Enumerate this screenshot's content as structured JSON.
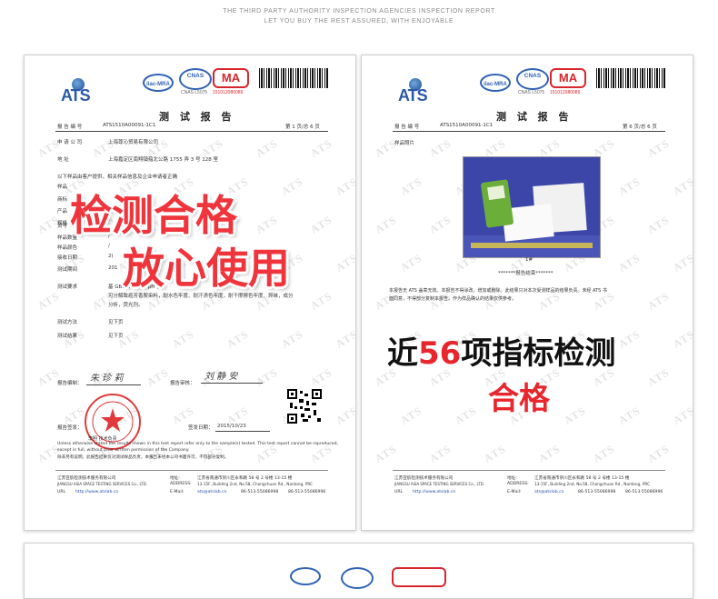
{
  "header": {
    "line1": "THE THIRD PARTY AUTHORITY INSPECTION AGENCIES INSPECTION REPORT",
    "line2": "LET YOU BUY THE REST ASSURED, WITH ENJOYABLE"
  },
  "watermark": "ATS",
  "logos": {
    "ats": "ATS",
    "ilac": "ilac-MRA",
    "cnas": "CNAS",
    "cnas_sub": "CNAS L5075",
    "ma": "MA",
    "ma_number": "151012080089"
  },
  "left_doc": {
    "title": "测 试 报 告",
    "report_no_label": "报 告 编 号",
    "report_no": "ATS1510A00091-1C1",
    "page": "第 1 页/总 6 页",
    "applicant_label": "申 请 公 司",
    "applicant": "上海尊沁贸易有限公司",
    "address_label": "地     址",
    "address": "上海嘉定区南翔镇蕴北公路 1755 弄 3 号 128 室",
    "note": "以下样品由客户提供，相关样品信息及企业申请者正确",
    "fields": [
      {
        "label": "样品数量",
        "value": "/"
      },
      {
        "label": "样品颜色",
        "value": "/"
      },
      {
        "label": "接收日期",
        "value": "2("
      },
      {
        "label": "测试期间",
        "value": "201"
      }
    ],
    "partial_labels": [
      "样品",
      "商标",
      "产品",
      "规格",
      "货号"
    ],
    "req_label": "测试要求",
    "req_text_1": "基   GB1   B 规   F下   pH 值,",
    "req_text_2": "可分解致癌芳香胺染料，耐水色牢度、耐汗渍色牢度，耐干摩擦色牢度、异味，成分",
    "req_text_3": "分析，荧光剂。",
    "method_label": "测试方法",
    "method": "见下页",
    "result_label": "测试结果",
    "result": "见下页",
    "compiler_label": "报告编制：",
    "compiler_sig": "朱 珍 莉",
    "reviewer_label": "报告审核：",
    "reviewer_sig": "刘 静 安",
    "approver_label": "报告签发：",
    "approver_name": "李明   技术负责",
    "issue_date_label": "签发日期：",
    "issue_date": "2015/10/23",
    "disclaimer_en_1": "Unless otherwise stated the results shown in this test report refer only to the sample(s) tested. This test report cannot be reproduced,",
    "disclaimer_en_2": "except in full, without prior written permission of the Company.",
    "disclaimer_cn_1": "除非另有说明，此报告结果仅对测试样品负责，本报告未经本公司书面许可，不可部分复制。",
    "footer_company_cn": "江苏亚航检测技术服务有限公司",
    "footer_company_en": "JIANGSU ASIA SPACE TESTING SERVICES Co., LTD.",
    "footer_url_label": "URL",
    "footer_url": "http://www.atslab.cn",
    "footer_addr_label": "地址:",
    "footer_addr_cn": "江苏省南通市崇川区永和路 58 号 2 号楼 13-15 楼",
    "footer_address_label": "ADDRESS:",
    "footer_addr_en": "13-15F, Building 2nd, No.58, Chongchuan Rd., Nantong, PRC",
    "footer_email_label": "E-Mail:",
    "footer_email": "ats@atslab.cn",
    "footer_tel": "86-513-55086998",
    "footer_fax": "86-513-55086996",
    "overlay_1": "检测合格",
    "overlay_2": "放心使用"
  },
  "right_doc": {
    "title": "测 试 报 告",
    "report_no_label": "报 告 编 号",
    "report_no": "ATS1510A00091-1C1",
    "page": "第 6 页/总 6 页",
    "photo_label": "样品照片",
    "photo_caption": "1#",
    "end_mark": "*******报告结束*******",
    "note_1": "本报告无 ATS 盖章无效。本报告不得涂改，增加或删除。此结果只对本次受测样品的结果负责。未经 ATS 书",
    "note_2": "面同意，不得部分复制本报告。作为样品确认的结果仅供参考。",
    "promo_pre": "近",
    "promo_num": "56",
    "promo_post": "项指标检测",
    "promo_line2": "合格",
    "footer_company_cn": "江苏亚航检测技术服务有限公司",
    "footer_company_en": "JIANGSU ASIA SPACE TESTING SERVICES Co., LTD.",
    "footer_url_label": "URL",
    "footer_url": "http://www.atslab.cn",
    "footer_addr_label": "地址:",
    "footer_addr_cn": "江苏省南通市崇川区永和路 58 号 2 号楼 13-15 楼",
    "footer_address_label": "ADDRESS:",
    "footer_addr_en": "13-15F, Building 2nd, No.58, Chongchuan Rd., Nantong, PRC",
    "footer_email_label": "E-Mail:",
    "footer_email": "ats@atslab.cn",
    "footer_tel": "86-513-55086998",
    "footer_fax": "86-513-55086996"
  },
  "colors": {
    "accent_red": "#f0343c",
    "logo_blue": "#2b5aa6",
    "ma_red": "#d8262d"
  }
}
